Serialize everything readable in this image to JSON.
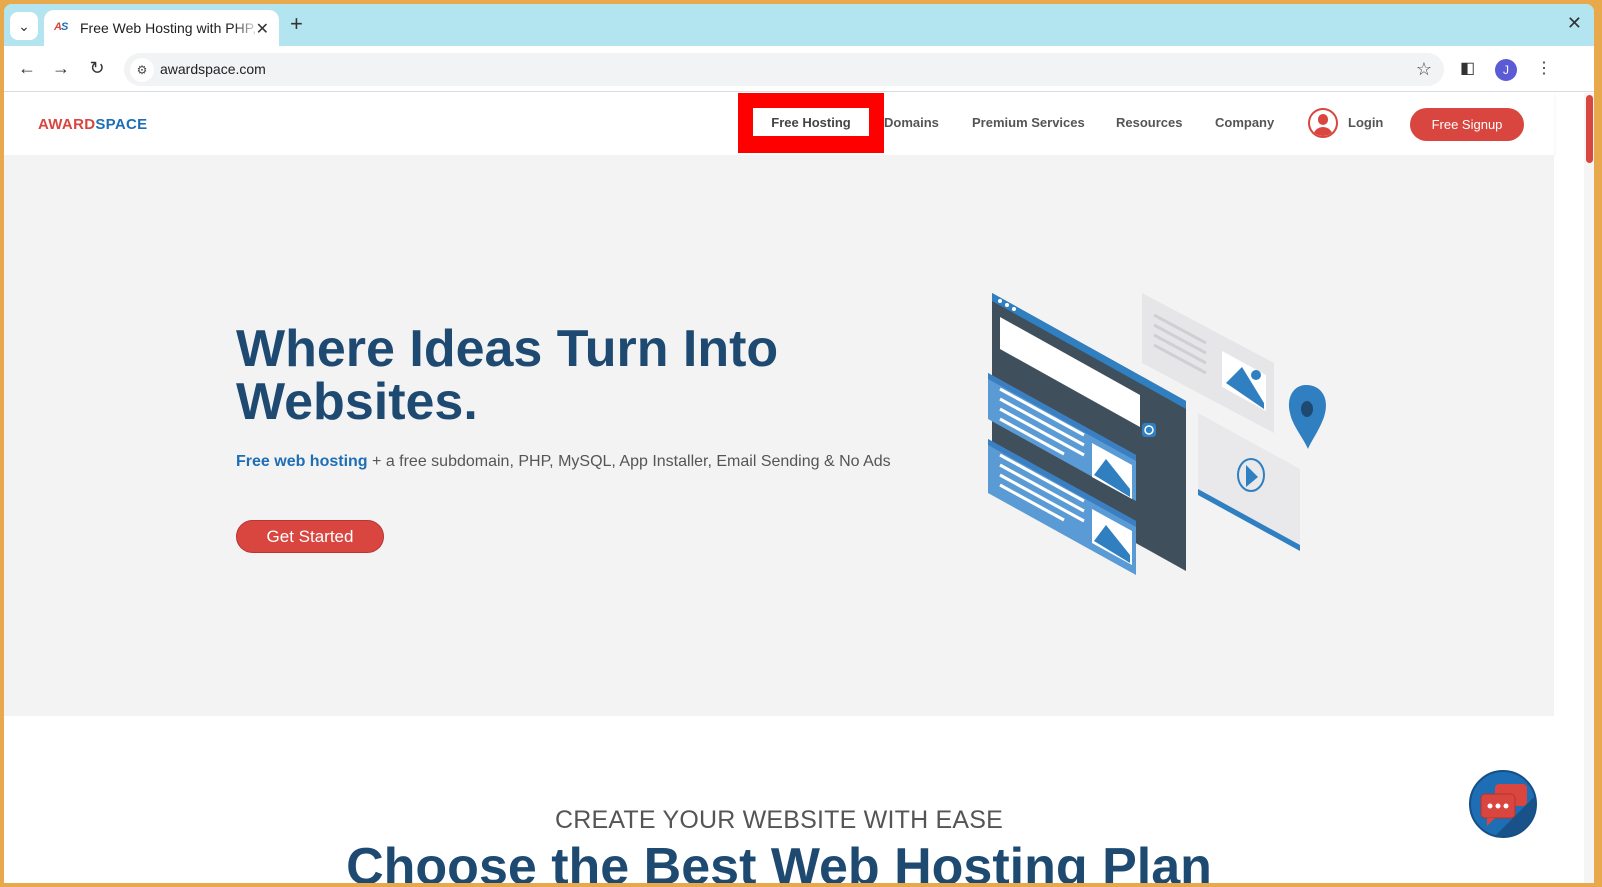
{
  "browser": {
    "tab_title": "Free Web Hosting with PHP, MySQL",
    "favicon_a": "A",
    "favicon_s": "S",
    "url": "awardspace.com",
    "profile_initial": "J"
  },
  "site": {
    "logo_part1": "AWARD",
    "logo_part2": "SPACE",
    "nav": {
      "free_hosting": "Free Hosting",
      "domains": "Domains",
      "premium": "Premium Services",
      "resources": "Resources",
      "company": "Company",
      "login": "Login",
      "signup": "Free Signup"
    },
    "hero": {
      "title": "Where Ideas Turn Into Websites.",
      "sub_highlight": "Free web hosting",
      "sub_rest": " + a free subdomain, PHP, MySQL, App Installer, Email Sending & No Ads",
      "cta": "Get Started"
    },
    "section2": {
      "eyebrow": "CREATE YOUR WEBSITE WITH EASE",
      "title": "Choose the Best Web Hosting Plan"
    }
  },
  "colors": {
    "brand_red": "#d9453f",
    "brand_blue": "#1e6eb5",
    "heading_navy": "#1e4a72",
    "highlight": "#ff0000"
  }
}
